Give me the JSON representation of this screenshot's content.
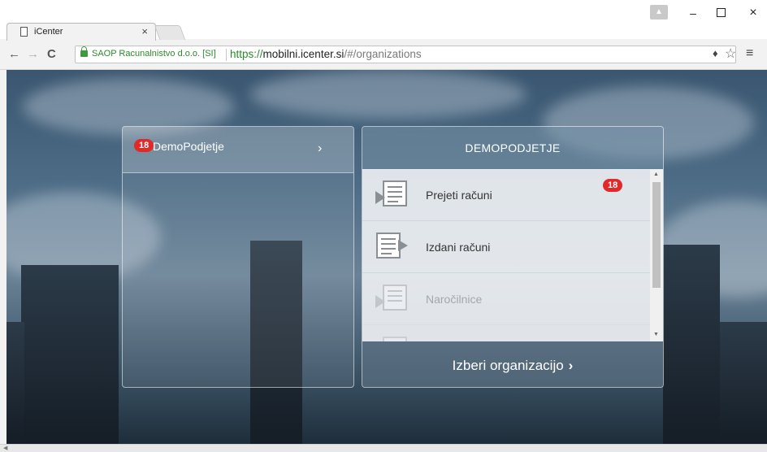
{
  "browser": {
    "tab_title": "iCenter",
    "tab_close": "×",
    "ev_org": "SAOP Racunalnistvo d.o.o. [SI]",
    "url_scheme": "https://",
    "url_host": "mobilni.icenter.si",
    "url_path": "/#/organizations",
    "back": "←",
    "forward": "→",
    "reload": "C",
    "minimize": "–",
    "close": "×"
  },
  "organization": {
    "name": "DemoPodjetje",
    "badge": "18",
    "chevron": "›"
  },
  "panel": {
    "title": "DEMOPODJETJE",
    "items": [
      {
        "label": "Prejeti računi",
        "badge": "18",
        "icon": "incoming-invoice-icon"
      },
      {
        "label": "Izdani računi",
        "badge": "",
        "icon": "outgoing-invoice-icon"
      },
      {
        "label": "Naročilnice",
        "badge": "",
        "icon": "order-icon"
      },
      {
        "label": "",
        "badge": "",
        "icon": "document-icon"
      }
    ],
    "select_label": "Izberi organizacijo",
    "select_chevron": "›"
  }
}
